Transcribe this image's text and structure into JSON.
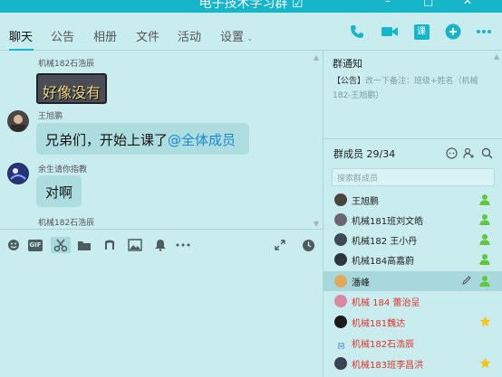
{
  "window": {
    "title": "电子技术学习群",
    "title_suffix": "☑"
  },
  "tabs": [
    {
      "label": "聊天",
      "active": true
    },
    {
      "label": "公告"
    },
    {
      "label": "相册"
    },
    {
      "label": "文件"
    },
    {
      "label": "活动"
    },
    {
      "label": "设置",
      "has_dropdown": true
    }
  ],
  "toolbar_icons": [
    "phone-icon",
    "video-call-icon",
    "class-icon",
    "add-icon",
    "more-icon"
  ],
  "toolbar_class_label": "课",
  "messages": [
    {
      "sender": "机械182石浩辰",
      "sticker_text": "好像没有"
    },
    {
      "sender": "王旭鹏",
      "text": "兄弟们，开始上课了",
      "mention": "@全体成员"
    },
    {
      "sender": "余生请你指教",
      "text": "对啊"
    },
    {
      "sender": "机械182石浩辰"
    }
  ],
  "input_toolbar_icons": [
    "emoji-icon",
    "gif-icon",
    "screenshot-scissors-icon",
    "folder-icon",
    "music-icon",
    "image-icon",
    "bell-icon",
    "more-dots-icon",
    "expand-icon",
    "history-clock-icon"
  ],
  "gif_label": "GIF",
  "notice": {
    "title": "群通知",
    "tag": "【公告】",
    "text": "改一下备注：班级+姓名（机械182-王旭鹏）"
  },
  "members": {
    "header": "群成员 29/34",
    "search_placeholder": "搜索群成员",
    "list": [
      {
        "name": "王旭鹏",
        "color": "#222222",
        "badge": "green-person"
      },
      {
        "name": "机械181班刘文皓",
        "color": "#222222",
        "badge": "green-person"
      },
      {
        "name": "机械182 王小丹",
        "color": "#222222",
        "badge": "green-person"
      },
      {
        "name": "机械184高嘉蔚",
        "color": "#222222",
        "badge": "green-person"
      },
      {
        "name": "潘峰",
        "color": "#222222",
        "badge": "green-person",
        "highlighted": true
      },
      {
        "name": "机械 184  蕾治呈",
        "color": "#e0342a",
        "badge": "none"
      },
      {
        "name": "机械181魏达",
        "color": "#e0342a",
        "badge": "star"
      },
      {
        "name": "机械182石浩辰",
        "color": "#e0342a",
        "badge": "none"
      },
      {
        "name": "机械183班李昌洪",
        "color": "#e0342a",
        "badge": "star"
      }
    ]
  },
  "colors": {
    "accent": "#17b5c9",
    "background": "#c9ecef",
    "mention": "#1a89d6",
    "vip_name": "#e0342a"
  }
}
